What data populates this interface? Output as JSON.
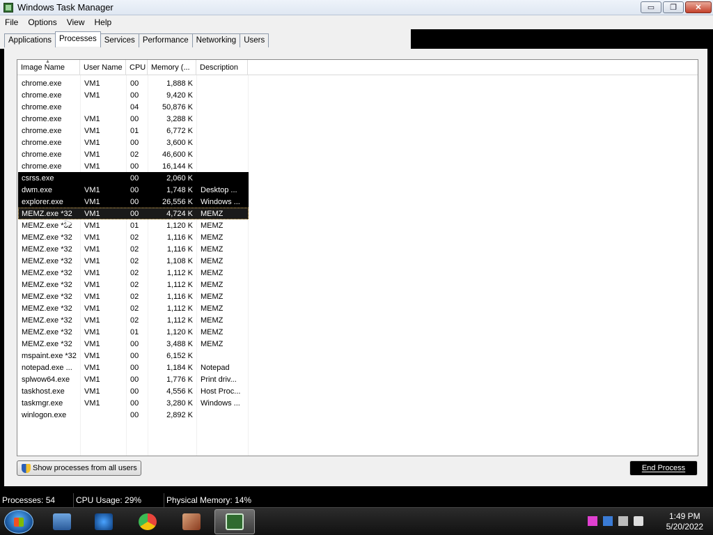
{
  "window": {
    "title": "Windows Task Manager",
    "min": "▭",
    "max": "❐",
    "close": "✕"
  },
  "menu": [
    "File",
    "Options",
    "View",
    "Help"
  ],
  "tabs": [
    "Applications",
    "Processes",
    "Services",
    "Performance",
    "Networking",
    "Users"
  ],
  "active_tab": "Processes",
  "columns": [
    "Image Name",
    "User Name",
    "CPU",
    "Memory (...",
    "Description"
  ],
  "processes": [
    {
      "name": "chrome.exe",
      "user": "VM1",
      "cpu": "00",
      "mem": "1,888 K",
      "desc": ""
    },
    {
      "name": "chrome.exe",
      "user": "VM1",
      "cpu": "00",
      "mem": "9,420 K",
      "desc": ""
    },
    {
      "name": "chrome.exe",
      "user": "",
      "cpu": "04",
      "mem": "50,876 K",
      "desc": ""
    },
    {
      "name": "chrome.exe",
      "user": "VM1",
      "cpu": "00",
      "mem": "3,288 K",
      "desc": ""
    },
    {
      "name": "chrome.exe",
      "user": "VM1",
      "cpu": "01",
      "mem": "6,772 K",
      "desc": ""
    },
    {
      "name": "chrome.exe",
      "user": "VM1",
      "cpu": "00",
      "mem": "3,600 K",
      "desc": ""
    },
    {
      "name": "chrome.exe",
      "user": "VM1",
      "cpu": "02",
      "mem": "46,600 K",
      "desc": ""
    },
    {
      "name": "chrome.exe",
      "user": "VM1",
      "cpu": "00",
      "mem": "16,144 K",
      "desc": ""
    },
    {
      "name": "csrss.exe",
      "user": "",
      "cpu": "00",
      "mem": "2,060 K",
      "desc": ""
    },
    {
      "name": "dwm.exe",
      "user": "VM1",
      "cpu": "00",
      "mem": "1,748 K",
      "desc": "Desktop ..."
    },
    {
      "name": "explorer.exe",
      "user": "VM1",
      "cpu": "00",
      "mem": "26,556 K",
      "desc": "Windows ..."
    },
    {
      "name": "MEMZ.exe *32",
      "user": "VM1",
      "cpu": "00",
      "mem": "4,724 K",
      "desc": "MEMZ"
    },
    {
      "name": "MEMZ.exe *32",
      "user": "VM1",
      "cpu": "01",
      "mem": "1,120 K",
      "desc": "MEMZ"
    },
    {
      "name": "MEMZ.exe *32",
      "user": "VM1",
      "cpu": "02",
      "mem": "1,116 K",
      "desc": "MEMZ"
    },
    {
      "name": "MEMZ.exe *32",
      "user": "VM1",
      "cpu": "02",
      "mem": "1,116 K",
      "desc": "MEMZ"
    },
    {
      "name": "MEMZ.exe *32",
      "user": "VM1",
      "cpu": "02",
      "mem": "1,108 K",
      "desc": "MEMZ"
    },
    {
      "name": "MEMZ.exe *32",
      "user": "VM1",
      "cpu": "02",
      "mem": "1,112 K",
      "desc": "MEMZ"
    },
    {
      "name": "MEMZ.exe *32",
      "user": "VM1",
      "cpu": "02",
      "mem": "1,112 K",
      "desc": "MEMZ"
    },
    {
      "name": "MEMZ.exe *32",
      "user": "VM1",
      "cpu": "02",
      "mem": "1,116 K",
      "desc": "MEMZ"
    },
    {
      "name": "MEMZ.exe *32",
      "user": "VM1",
      "cpu": "02",
      "mem": "1,112 K",
      "desc": "MEMZ"
    },
    {
      "name": "MEMZ.exe *32",
      "user": "VM1",
      "cpu": "02",
      "mem": "1,112 K",
      "desc": "MEMZ"
    },
    {
      "name": "MEMZ.exe *32",
      "user": "VM1",
      "cpu": "01",
      "mem": "1,120 K",
      "desc": "MEMZ"
    },
    {
      "name": "MEMZ.exe *32",
      "user": "VM1",
      "cpu": "00",
      "mem": "3,488 K",
      "desc": "MEMZ"
    },
    {
      "name": "mspaint.exe *32",
      "user": "VM1",
      "cpu": "00",
      "mem": "6,152 K",
      "desc": ""
    },
    {
      "name": "notepad.exe ...",
      "user": "VM1",
      "cpu": "00",
      "mem": "1,184 K",
      "desc": "Notepad"
    },
    {
      "name": "splwow64.exe",
      "user": "VM1",
      "cpu": "00",
      "mem": "1,776 K",
      "desc": "Print driv..."
    },
    {
      "name": "taskhost.exe",
      "user": "VM1",
      "cpu": "00",
      "mem": "4,556 K",
      "desc": "Host Proc..."
    },
    {
      "name": "taskmgr.exe",
      "user": "VM1",
      "cpu": "00",
      "mem": "3,280 K",
      "desc": "Windows ..."
    },
    {
      "name": "winlogon.exe",
      "user": "",
      "cpu": "00",
      "mem": "2,892 K",
      "desc": ""
    }
  ],
  "dark_rows": [
    8,
    9,
    10
  ],
  "selected_row": 11,
  "buttons": {
    "show_all": "Show processes from all users",
    "end_process": "End Process"
  },
  "status": {
    "processes": "Processes: 54",
    "cpu": "CPU Usage: 29%",
    "memory": "Physical Memory: 14%"
  },
  "clock": {
    "time": "1:49 PM",
    "date": "5/20/2022"
  },
  "colors": {
    "chrome": "#e8453c",
    "paint": "#b5532f"
  }
}
